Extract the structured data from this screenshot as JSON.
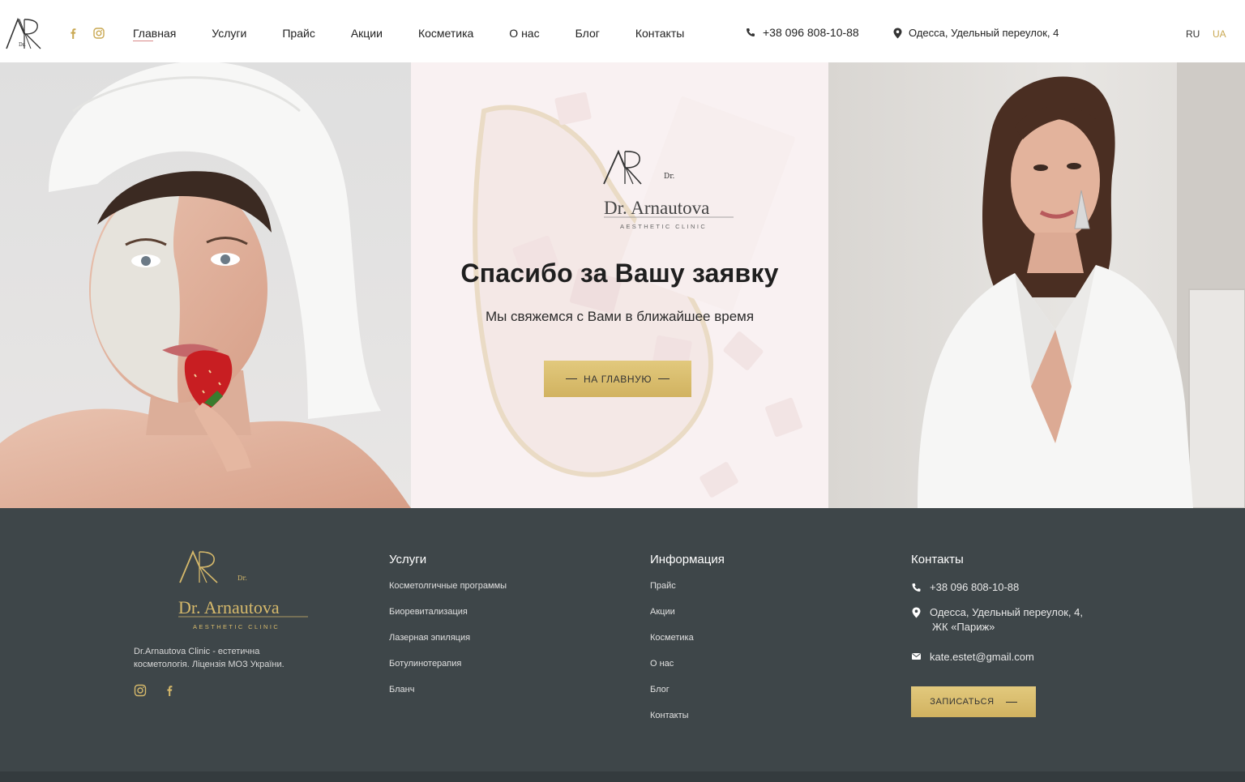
{
  "header": {
    "logo_label": "Dr.",
    "nav": [
      "Главная",
      "Услуги",
      "Прайс",
      "Акции",
      "Косметика",
      "О нас",
      "Блог",
      "Контакты"
    ],
    "phone": "+38 096 808-10-88",
    "address": "Одесса, Удельный переулок, 4",
    "lang_ru": "RU",
    "lang_ua": "UA"
  },
  "hero": {
    "brand_dr": "Dr.",
    "brand_name": "Dr. Arnautova",
    "brand_tagline": "AESTHETIC CLINIC",
    "title": "Спасибо за Вашу заявку",
    "subtitle": "Мы свяжемся с Вами в ближайшее время",
    "button": "НА ГЛАВНУЮ"
  },
  "footer": {
    "brand_dr": "Dr.",
    "brand_name": "Dr. Arnautova",
    "brand_tagline": "AESTHETIC CLINIC",
    "description": "Dr.Arnautova Clinic - естетична косметологія. Ліцензія МОЗ України.",
    "services_title": "Услуги",
    "services": [
      "Косметолгичные программы",
      "Биоревитализация",
      "Лазерная эпиляция",
      "Ботулинотерапия",
      "Бланч"
    ],
    "info_title": "Информация",
    "info": [
      "Прайс",
      "Акции",
      "Косметика",
      "О нас",
      "Блог",
      "Контакты"
    ],
    "contacts_title": "Контакты",
    "phone": "+38 096 808-10-88",
    "address_line1": "Одесса, Удельный переулок, 4,",
    "address_line2": "ЖК «Париж»",
    "email": "kate.estet@gmail.com",
    "button": "ЗАПИСАТЬСЯ"
  },
  "colors": {
    "gold": "#d6b96b",
    "footer_bg": "#3e4649",
    "hero_mid_bg": "#f9f1f2"
  }
}
